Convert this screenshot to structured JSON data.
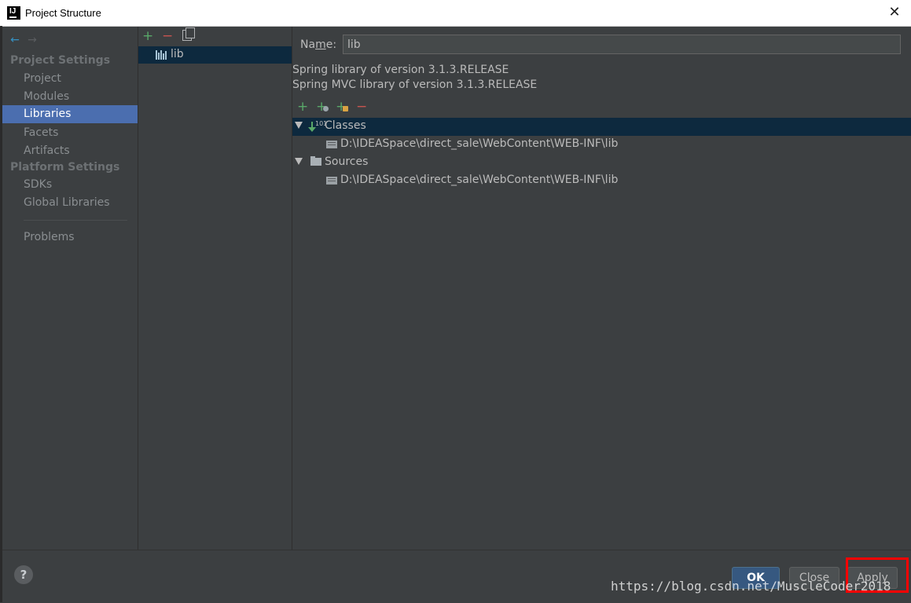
{
  "window": {
    "title": "Project Structure",
    "close_glyph": "✕"
  },
  "nav": {
    "back_icon": "←",
    "forward_icon": "→"
  },
  "sidebar": {
    "project_settings_header": "Project Settings",
    "project_items": [
      "Project",
      "Modules",
      "Libraries",
      "Facets",
      "Artifacts"
    ],
    "selected_item": "Libraries",
    "platform_settings_header": "Platform Settings",
    "platform_items": [
      "SDKs",
      "Global Libraries"
    ],
    "problems_label": "Problems"
  },
  "libraries_panel": {
    "toolbar": {
      "add_icon": "+",
      "remove_icon": "−",
      "copy_icon": "copy-icon"
    },
    "items": [
      "lib"
    ]
  },
  "detail": {
    "name_label_prefix": "Na",
    "name_label_mnemonic": "m",
    "name_label_suffix": "e:",
    "name_value": "lib",
    "descriptions": [
      "Spring library of version 3.1.3.RELEASE",
      "Spring MVC library of version 3.1.3.RELEASE"
    ],
    "tree_toolbar": {
      "add": "+",
      "add_jar": "+",
      "add_url": "+",
      "remove": "−"
    },
    "tree": {
      "classes_label": "Classes",
      "classes_path": "D:\\IDEASpace\\direct_sale\\WebContent\\WEB-INF\\lib",
      "sources_label": "Sources",
      "sources_path": "D:\\IDEASpace\\direct_sale\\WebContent\\WEB-INF\\lib"
    }
  },
  "footer": {
    "help": "?",
    "ok_label": "OK",
    "close_label": "Close",
    "apply_label": "Apply",
    "watermark": "https://blog.csdn.net/MuscleCoder2018"
  },
  "colors": {
    "selection": "#4b6eaf",
    "tree_selection": "#0d293e",
    "add_green": "#59a869",
    "remove_red": "#c75450",
    "annotation_red": "#ff0000"
  }
}
